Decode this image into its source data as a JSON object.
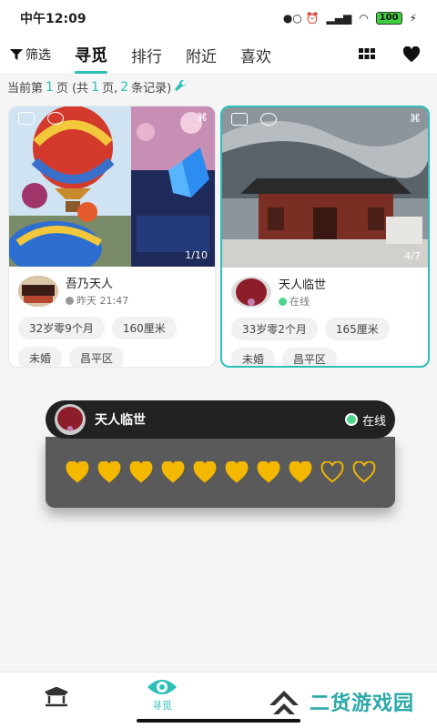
{
  "status": {
    "time": "中午12:09",
    "battery": "100"
  },
  "nav": {
    "filter_label": "筛选",
    "tabs": [
      {
        "label": "寻觅",
        "active": true
      },
      {
        "label": "排行",
        "active": false
      },
      {
        "label": "附近",
        "active": false
      },
      {
        "label": "喜欢",
        "active": false
      }
    ]
  },
  "page_info": {
    "prefix": "当前第",
    "page": "1",
    "mid1": "页 (共",
    "total_pages": "1",
    "mid2": "页,",
    "records": "2",
    "suffix": "条记录)"
  },
  "cards": [
    {
      "image_count": "1/10",
      "name": "吾乃天人",
      "status": "昨天 21:47",
      "status_color": "#999999",
      "tags": [
        "32岁零9个月",
        "160厘米",
        "未婚",
        "昌平区"
      ]
    },
    {
      "image_count": "4/7",
      "name": "天人临世",
      "status": "在线",
      "status_color": "#4cd68a",
      "tags": [
        "33岁零2个月",
        "165厘米",
        "未婚",
        "昌平区"
      ]
    }
  ],
  "popup": {
    "name": "天人临世",
    "status": "在线",
    "rating_filled": 8,
    "rating_total": 10
  },
  "bottom": {
    "active_tab": "寻觅"
  },
  "watermark": "二货游戏园",
  "colors": {
    "accent": "#2bbfb8",
    "heart": "#f5b800"
  }
}
